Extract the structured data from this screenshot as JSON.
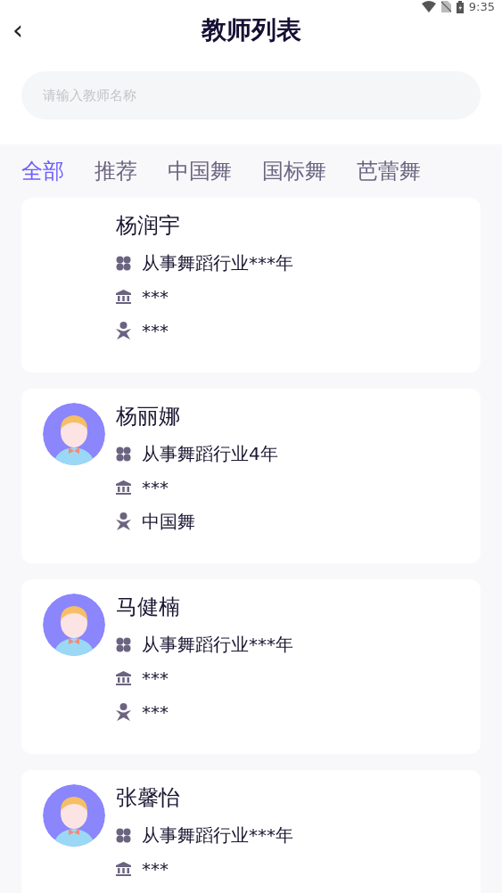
{
  "status_bar": {
    "time": "9:35"
  },
  "header": {
    "back": "‹",
    "title": "教师列表"
  },
  "search": {
    "placeholder": "请输入教师名称"
  },
  "tabs": [
    {
      "label": "全部",
      "selected": true
    },
    {
      "label": "推荐",
      "selected": false
    },
    {
      "label": "中国舞",
      "selected": false
    },
    {
      "label": "国标舞",
      "selected": false
    },
    {
      "label": "芭蕾舞",
      "selected": false
    }
  ],
  "teachers": [
    {
      "name": "杨润宇",
      "has_avatar": false,
      "experience": "从事舞蹈行业***年",
      "institution": "***",
      "specialty": "***"
    },
    {
      "name": "杨丽娜",
      "has_avatar": true,
      "experience": "从事舞蹈行业4年",
      "institution": "***",
      "specialty": "中国舞"
    },
    {
      "name": "马健楠",
      "has_avatar": true,
      "experience": "从事舞蹈行业***年",
      "institution": "***",
      "specialty": "***"
    },
    {
      "name": "张馨怡",
      "has_avatar": true,
      "experience": "从事舞蹈行业***年",
      "institution": "***"
    }
  ]
}
